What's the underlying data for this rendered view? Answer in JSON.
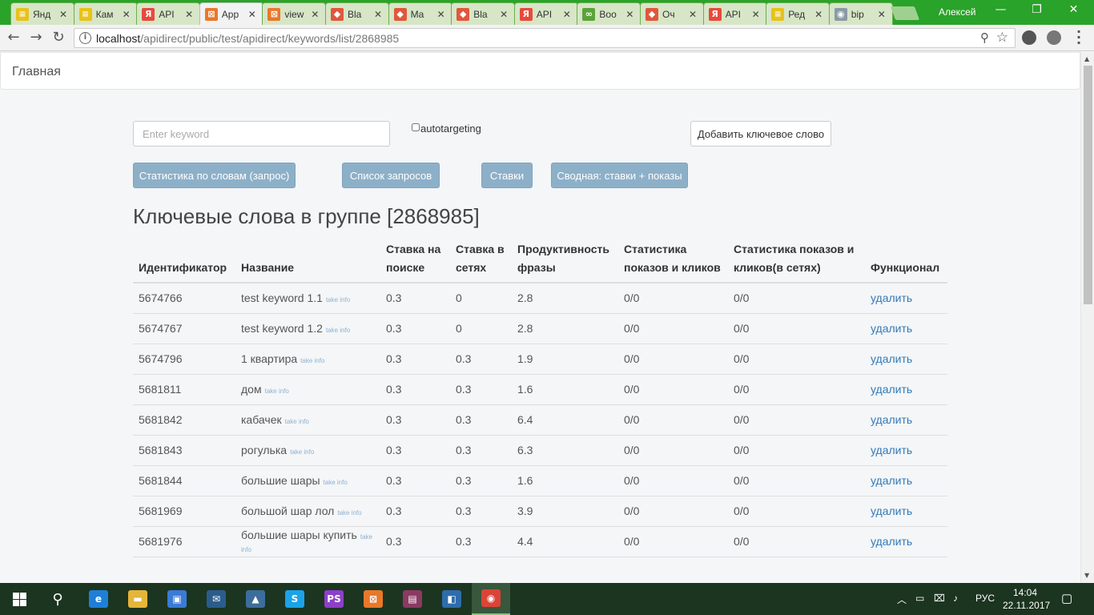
{
  "browser": {
    "tabs": [
      {
        "title": "Янд",
        "icon": "yellow-chat-icon",
        "color": "#e8c21a",
        "glyph": "≡"
      },
      {
        "title": "Кам",
        "icon": "yellow-chat-icon",
        "color": "#e8c21a",
        "glyph": "≡"
      },
      {
        "title": "API",
        "icon": "yandex-icon",
        "color": "#e74a3b",
        "glyph": "Я"
      },
      {
        "title": "App",
        "icon": "xampp-icon",
        "color": "#e8782a",
        "glyph": "⊠",
        "active": true
      },
      {
        "title": "view",
        "icon": "xampp-icon",
        "color": "#e8782a",
        "glyph": "⊠"
      },
      {
        "title": "Bla",
        "icon": "laravel-icon",
        "color": "#e0573c",
        "glyph": "◆"
      },
      {
        "title": "Ma",
        "icon": "laravel-icon",
        "color": "#e0573c",
        "glyph": "◆"
      },
      {
        "title": "Bla",
        "icon": "laravel-icon",
        "color": "#e0573c",
        "glyph": "◆"
      },
      {
        "title": "API",
        "icon": "yandex-icon",
        "color": "#e74a3b",
        "glyph": "Я"
      },
      {
        "title": "Boo",
        "icon": "green-link-icon",
        "color": "#5aa33a",
        "glyph": "∞"
      },
      {
        "title": "Оч",
        "icon": "laravel-icon",
        "color": "#e0573c",
        "glyph": "◆"
      },
      {
        "title": "API",
        "icon": "yandex-icon",
        "color": "#e74a3b",
        "glyph": "Я"
      },
      {
        "title": "Ред",
        "icon": "yellow-chat-icon",
        "color": "#e8c21a",
        "glyph": "≡"
      },
      {
        "title": "bip",
        "icon": "globe-icon",
        "color": "#8a9aa6",
        "glyph": "◉"
      }
    ],
    "profile_name": "Алексей",
    "url_host": "localhost",
    "url_path": "/apidirect/public/test/apidirect/keywords/list/2868985"
  },
  "navbar": {
    "brand": "Главная"
  },
  "form": {
    "keyword_placeholder": "Enter keyword",
    "autotargeting_label": "autotargeting",
    "add_button": "Добавить ключевое слово"
  },
  "actions": [
    {
      "label": "Статистика по словам (запрос)",
      "name": "word-stats-button"
    },
    {
      "label": "Список запросов",
      "name": "requests-list-button"
    },
    {
      "label": "Ставки",
      "name": "bids-button"
    },
    {
      "label": "Сводная: ставки + показы",
      "name": "summary-button"
    }
  ],
  "heading": {
    "text": "Ключевые слова в группе",
    "group_id": "[2868985]"
  },
  "table": {
    "columns": [
      "Идентификатор",
      "Название",
      "Ставка на поиске",
      "Ставка в сетях",
      "Продуктивность фразы",
      "Статистика показов и кликов",
      "Статистика показов и кликов(в сетях)",
      "Функционал"
    ],
    "take_info_label": "take info",
    "delete_label": "удалить",
    "rows": [
      {
        "id": "5674766",
        "name": "test keyword 1.1",
        "search_bid": "0.3",
        "network_bid": "0",
        "productivity": "2.8",
        "stats": "0/0",
        "network_stats": "0/0"
      },
      {
        "id": "5674767",
        "name": "test keyword 1.2",
        "search_bid": "0.3",
        "network_bid": "0",
        "productivity": "2.8",
        "stats": "0/0",
        "network_stats": "0/0"
      },
      {
        "id": "5674796",
        "name": "1 квартира",
        "search_bid": "0.3",
        "network_bid": "0.3",
        "productivity": "1.9",
        "stats": "0/0",
        "network_stats": "0/0"
      },
      {
        "id": "5681811",
        "name": "дом",
        "search_bid": "0.3",
        "network_bid": "0.3",
        "productivity": "1.6",
        "stats": "0/0",
        "network_stats": "0/0"
      },
      {
        "id": "5681842",
        "name": "кабачек",
        "search_bid": "0.3",
        "network_bid": "0.3",
        "productivity": "6.4",
        "stats": "0/0",
        "network_stats": "0/0"
      },
      {
        "id": "5681843",
        "name": "рогулька",
        "search_bid": "0.3",
        "network_bid": "0.3",
        "productivity": "6.3",
        "stats": "0/0",
        "network_stats": "0/0"
      },
      {
        "id": "5681844",
        "name": "большие шары",
        "search_bid": "0.3",
        "network_bid": "0.3",
        "productivity": "1.6",
        "stats": "0/0",
        "network_stats": "0/0"
      },
      {
        "id": "5681969",
        "name": "большой шар лол",
        "search_bid": "0.3",
        "network_bid": "0.3",
        "productivity": "3.9",
        "stats": "0/0",
        "network_stats": "0/0"
      },
      {
        "id": "5681976",
        "name": "большие шары купить",
        "search_bid": "0.3",
        "network_bid": "0.3",
        "productivity": "4.4",
        "stats": "0/0",
        "network_stats": "0/0"
      }
    ]
  },
  "taskbar": {
    "apps": [
      {
        "name": "edge-icon",
        "color": "#1f7fd6",
        "glyph": "e"
      },
      {
        "name": "file-explorer-icon",
        "color": "#e5b53a",
        "glyph": "▬"
      },
      {
        "name": "store-icon",
        "color": "#3a7bd5",
        "glyph": "▣"
      },
      {
        "name": "mail-icon",
        "color": "#2b5d8c",
        "glyph": "✉"
      },
      {
        "name": "photos-icon",
        "color": "#3c6e9c",
        "glyph": "▲"
      },
      {
        "name": "skype-icon",
        "color": "#1aa3e8",
        "glyph": "S"
      },
      {
        "name": "phpstorm-icon",
        "color": "#8d3fc9",
        "glyph": "PS"
      },
      {
        "name": "xampp-icon",
        "color": "#e8782a",
        "glyph": "⊠"
      },
      {
        "name": "winrar-icon",
        "color": "#8b3a62",
        "glyph": "▤"
      },
      {
        "name": "virtualbox-icon",
        "color": "#2f6cab",
        "glyph": "◧"
      },
      {
        "name": "chrome-icon",
        "color": "#db4437",
        "glyph": "◉",
        "active": true
      }
    ],
    "lang": "РУС",
    "time": "14:04",
    "date": "22.11.2017"
  }
}
